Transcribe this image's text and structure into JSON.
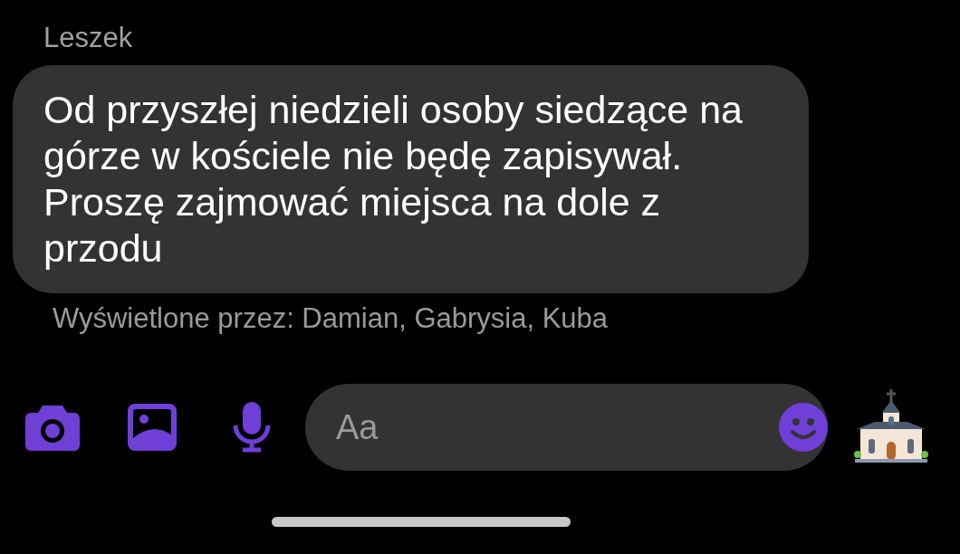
{
  "message": {
    "sender": "Leszek",
    "text": "Od przyszłej niedzieli osoby siedzące na górze w kościele nie będę zapisywał. Proszę zajmować miejsca na dole z przodu",
    "seen_by": "Wyświetlone przez: Damian, Gabrysia, Kuba"
  },
  "composer": {
    "placeholder": "Aa"
  }
}
